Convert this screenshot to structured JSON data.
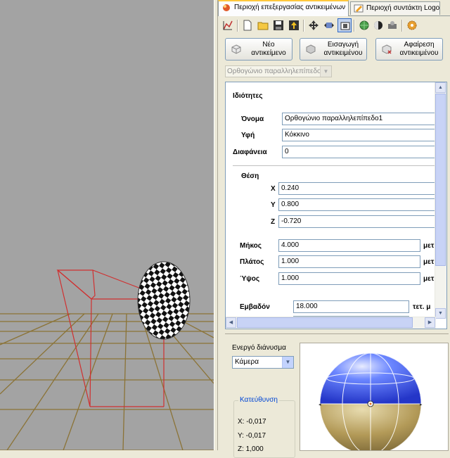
{
  "tabs": [
    {
      "label": "Περιοχή επεξεργασίας αντικειμένων",
      "icon": "objects-globe-icon",
      "active": true
    },
    {
      "label": "Περιοχή συντάκτη Logo",
      "icon": "logo-editor-icon",
      "active": false
    }
  ],
  "toolbar": {
    "icons": [
      "chart-icon",
      "new-document-icon",
      "open-folder-icon",
      "save-icon",
      "export-icon",
      "move-icon",
      "scale-icon",
      "frame-icon",
      "globe-icon",
      "shade-icon",
      "camera-icon",
      "settings-icon"
    ]
  },
  "actions": {
    "new_object": "Νέο αντικείμενο",
    "import_object": "Εισαγωγή αντικειμένου",
    "remove_object": "Αφαίρεση αντικειμένου"
  },
  "object_selector": {
    "value": "Ορθογώνιο παραλληλεπίπεδο"
  },
  "properties": {
    "heading": "Ιδιότητες",
    "name_label": "Όνομα",
    "name_value": "Ορθογώνιο παραλληλεπίπεδο1",
    "texture_label": "Υφή",
    "texture_value": "Κόκκινο",
    "opacity_label": "Διαφάνεια",
    "opacity_value": "0",
    "position_label": "Θέση",
    "x_label": "X",
    "x_value": "0.240",
    "y_label": "Y",
    "y_value": "0.800",
    "z_label": "Z",
    "z_value": "-0.720",
    "length_label": "Μήκος",
    "length_value": "4.000",
    "length_unit": "μετ",
    "width_label": "Πλάτος",
    "width_value": "1.000",
    "width_unit": "μετ",
    "height_label": "Ύψος",
    "height_value": "1.000",
    "height_unit": "μετ",
    "area_label": "Εμβαδόν",
    "area_value": "18.000",
    "area_unit": "τετ. μ"
  },
  "vector": {
    "label": "Ενεργό διάνυσμα",
    "selected": "Κάμερα",
    "direction_title": "Κατεύθυνση",
    "x": "X: -0,017",
    "y": "Y: -0,017",
    "z": "Z: 1,000"
  },
  "colors": {
    "viewport_bg": "#a3a3a3",
    "grid_line": "#8b7336",
    "wireframe": "#d03030",
    "sphere_top": "#3a5ff0",
    "sphere_bottom": "#b39a58",
    "panel_bg": "#ece9d8",
    "tab_accent": "#ffc83c"
  }
}
